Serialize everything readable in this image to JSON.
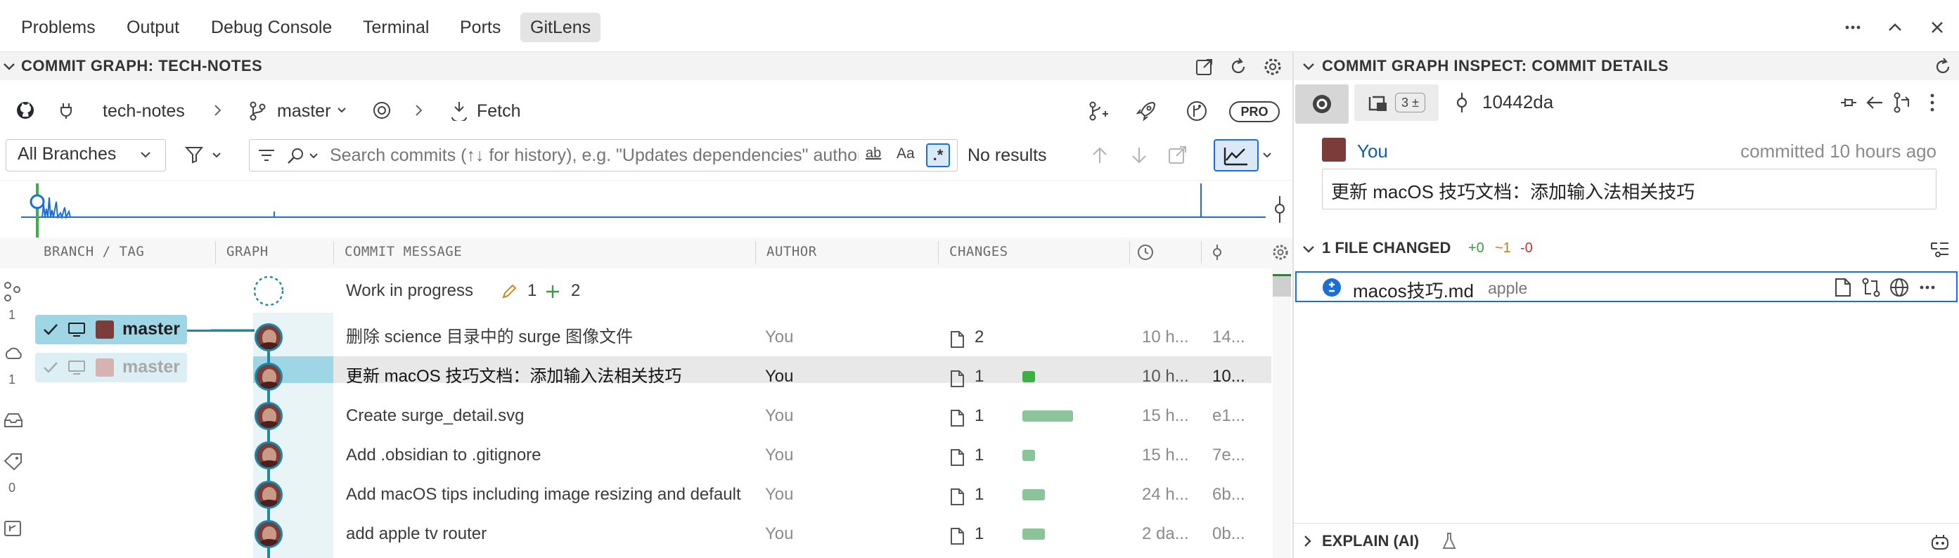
{
  "panel_tabs": [
    "Problems",
    "Output",
    "Debug Console",
    "Terminal",
    "Ports",
    "GitLens"
  ],
  "left_header": {
    "title": "COMMIT GRAPH: TECH-NOTES"
  },
  "right_header": {
    "title": "COMMIT GRAPH INSPECT: COMMIT DETAILS"
  },
  "toolbar": {
    "repo": "tech-notes",
    "branch": "master",
    "fetch": "Fetch",
    "pro": "PRO",
    "branches_select": "All Branches",
    "search_placeholder": "Search commits (↑↓ for history), e.g. \"Updates dependencies\" author:eamodio",
    "match_case": "ab",
    "match_word": "Aa",
    "regex": ".*",
    "no_results": "No results"
  },
  "columns": {
    "branch_tag": "BRANCH / TAG",
    "graph": "GRAPH",
    "commit_message": "COMMIT MESSAGE",
    "author": "AUTHOR",
    "changes": "CHANGES"
  },
  "side_counts": {
    "branches": "1",
    "remotes": "1",
    "tags": "0"
  },
  "wip": {
    "label": "Work in progress",
    "modified": "1",
    "added": "2"
  },
  "branch_badges": [
    {
      "name": "master"
    },
    {
      "name": "master"
    }
  ],
  "commits": [
    {
      "message": "删除 science 目录中的 surge 图像文件",
      "author": "You",
      "files": "2",
      "bar_fraction": 0.0,
      "time": "10 h...",
      "sha": "14..."
    },
    {
      "message": "更新 macOS 技巧文档：添加输入法相关技巧",
      "author": "You",
      "files": "1",
      "bar_fraction": 0.25,
      "time": "10 h...",
      "sha": "10..."
    },
    {
      "message": "Create surge_detail.svg",
      "author": "You",
      "files": "1",
      "bar_fraction": 1.0,
      "time": "15 h...",
      "sha": "e1..."
    },
    {
      "message": "Add .obsidian to .gitignore",
      "author": "You",
      "files": "1",
      "bar_fraction": 0.25,
      "time": "15 h...",
      "sha": "7e..."
    },
    {
      "message": "Add macOS tips including image resizing and default",
      "author": "You",
      "files": "1",
      "bar_fraction": 0.45,
      "time": "24 h...",
      "sha": "6b..."
    },
    {
      "message": "add apple tv router",
      "author": "You",
      "files": "1",
      "bar_fraction": 0.45,
      "time": "2 da...",
      "sha": "0b..."
    }
  ],
  "details": {
    "stash_count": "3 ±",
    "sha": "10442da",
    "author": "You",
    "committed": "committed 10 hours ago",
    "message": "更新 macOS 技巧文档：添加输入法相关技巧",
    "files_changed": "1 FILE CHANGED",
    "stat_add": "+0",
    "stat_mod": "~1",
    "stat_del": "-0",
    "file_name": "macos技巧.md",
    "file_dir": "apple",
    "explain": "EXPLAIN (AI)"
  },
  "colors": {
    "accent": "#1a88a8",
    "selected_row": "#e8e8e8",
    "badge": "#9fd6e6",
    "link": "#0f5cad"
  }
}
